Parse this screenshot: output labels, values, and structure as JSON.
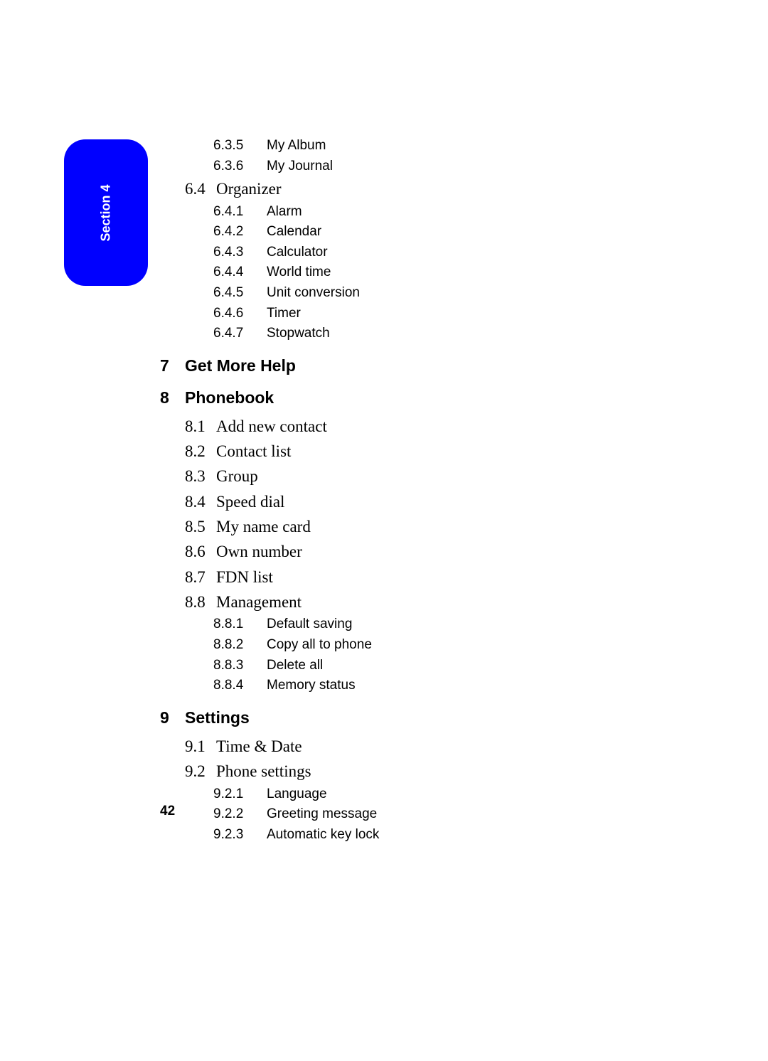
{
  "section_tab": "Section 4",
  "page_number": "42",
  "items": [
    {
      "level": "tiny",
      "num": "6.3.5",
      "text": "My Album"
    },
    {
      "level": "tiny",
      "num": "6.3.6",
      "text": "My Journal"
    },
    {
      "level": "sub",
      "num": "6.4",
      "text": "Organizer"
    },
    {
      "level": "tiny",
      "num": "6.4.1",
      "text": "Alarm"
    },
    {
      "level": "tiny",
      "num": "6.4.2",
      "text": "Calendar"
    },
    {
      "level": "tiny",
      "num": "6.4.3",
      "text": "Calculator"
    },
    {
      "level": "tiny",
      "num": "6.4.4",
      "text": "World time"
    },
    {
      "level": "tiny",
      "num": "6.4.5",
      "text": "Unit conversion"
    },
    {
      "level": "tiny",
      "num": "6.4.6",
      "text": "Timer"
    },
    {
      "level": "tiny",
      "num": "6.4.7",
      "text": "Stopwatch"
    },
    {
      "level": "major",
      "num": "7",
      "text": "Get More Help"
    },
    {
      "level": "major",
      "num": "8",
      "text": "Phonebook"
    },
    {
      "level": "sub",
      "num": "8.1",
      "text": "Add new contact"
    },
    {
      "level": "sub",
      "num": "8.2",
      "text": "Contact list"
    },
    {
      "level": "sub",
      "num": "8.3",
      "text": "Group"
    },
    {
      "level": "sub",
      "num": "8.4",
      "text": "Speed dial"
    },
    {
      "level": "sub",
      "num": "8.5",
      "text": "My name card"
    },
    {
      "level": "sub",
      "num": "8.6",
      "text": "Own number"
    },
    {
      "level": "sub",
      "num": "8.7",
      "text": "FDN list"
    },
    {
      "level": "sub",
      "num": "8.8",
      "text": "Management"
    },
    {
      "level": "tiny",
      "num": "8.8.1",
      "text": "Default saving"
    },
    {
      "level": "tiny",
      "num": "8.8.2",
      "text": "Copy all to phone"
    },
    {
      "level": "tiny",
      "num": "8.8.3",
      "text": "Delete all"
    },
    {
      "level": "tiny",
      "num": "8.8.4",
      "text": "Memory status"
    },
    {
      "level": "major",
      "num": "9",
      "text": "Settings"
    },
    {
      "level": "sub",
      "num": "9.1",
      "text": "Time & Date"
    },
    {
      "level": "sub",
      "num": "9.2",
      "text": "Phone settings"
    },
    {
      "level": "tiny",
      "num": "9.2.1",
      "text": "Language"
    },
    {
      "level": "tiny",
      "num": "9.2.2",
      "text": "Greeting message"
    },
    {
      "level": "tiny",
      "num": "9.2.3",
      "text": "Automatic key lock"
    }
  ]
}
